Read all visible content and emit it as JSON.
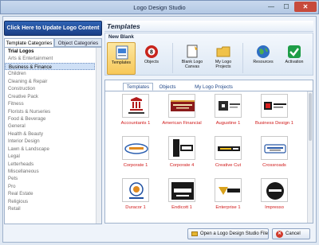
{
  "window": {
    "title": "Logo Design Studio",
    "minimize": "—",
    "maximize": "☐",
    "close": "✕"
  },
  "update_button": "Click Here to Update Logo Content",
  "left_tabs": [
    "Template Categories",
    "Object Categories"
  ],
  "categories": [
    "Trial Logos",
    "Arts & Entertainment",
    "Business & Finance",
    "Children",
    "Cleaning & Repair",
    "Construction",
    "Creative Pack",
    "Fitness",
    "Florists & Nurseries",
    "Food & Beverage",
    "General",
    "Health & Beauty",
    "Interior Design",
    "Lawn & Landscape",
    "Legal",
    "Letterheads",
    "Miscellaneous",
    "Pets",
    "Pro",
    "Real Estate",
    "Religious",
    "Retail"
  ],
  "selected_category": "Business & Finance",
  "templates_header": "Templates",
  "ribbon": {
    "group_label": "New Blank",
    "buttons": [
      {
        "label": "Templates",
        "icon": "templates-icon",
        "active": true
      },
      {
        "label": "Objects",
        "icon": "objects-icon",
        "active": false
      },
      {
        "label": "Blank Logo Canvas",
        "icon": "blank-canvas-icon",
        "active": false
      },
      {
        "label": "My Logo Projects",
        "icon": "folder-icon",
        "active": false
      },
      {
        "label": "Resources",
        "icon": "globe-icon",
        "active": false
      },
      {
        "label": "Activation",
        "icon": "checkmark-icon",
        "active": false
      }
    ]
  },
  "content_tabs": [
    "Templates",
    "Objects",
    "My Logo Projects"
  ],
  "tiles": [
    {
      "name": "Accountants 1"
    },
    {
      "name": "American Financial"
    },
    {
      "name": "Augustine 1"
    },
    {
      "name": "Business Design 1"
    },
    {
      "name": "Corporate 1"
    },
    {
      "name": "Corporate 4"
    },
    {
      "name": "Creative Cut"
    },
    {
      "name": "Crossroads"
    },
    {
      "name": "Duracor 1"
    },
    {
      "name": "Endicott 1"
    },
    {
      "name": "Enterprise 1"
    },
    {
      "name": "Impresso"
    }
  ],
  "footer": {
    "open_button": "Open a Logo Design Studio File",
    "cancel_button": "Cancel"
  }
}
